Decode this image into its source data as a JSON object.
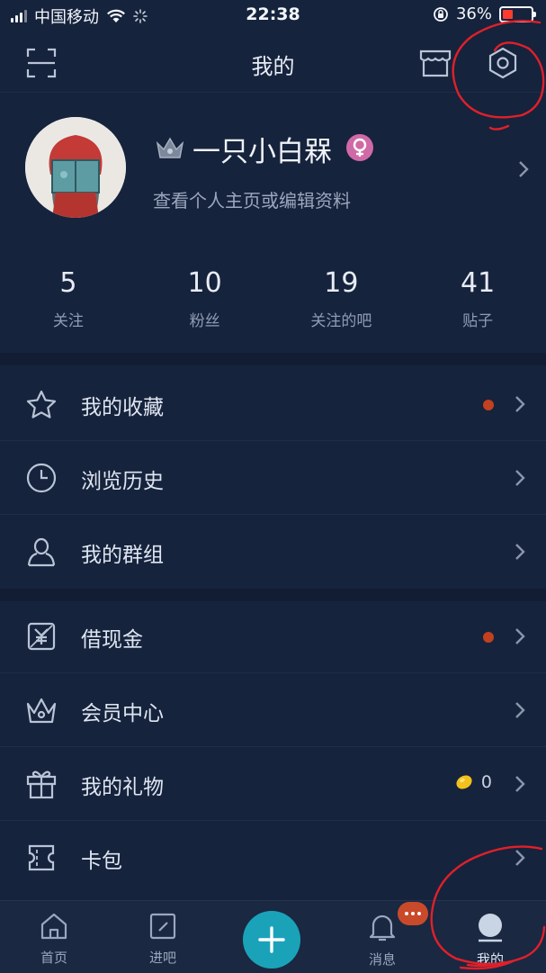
{
  "status_bar": {
    "carrier": "中国移动",
    "time": "22:38",
    "battery": "36%"
  },
  "nav": {
    "title": "我的",
    "icons": [
      "scan-icon",
      "store-icon",
      "settings-icon"
    ]
  },
  "profile": {
    "username": "一只小白槑",
    "subtitle": "查看个人主页或编辑资料",
    "gender": "female"
  },
  "stats": [
    {
      "value": "5",
      "label": "关注"
    },
    {
      "value": "10",
      "label": "粉丝"
    },
    {
      "value": "19",
      "label": "关注的吧"
    },
    {
      "value": "41",
      "label": "贴子"
    }
  ],
  "menu": {
    "favorites": "我的收藏",
    "history": "浏览历史",
    "groups": "我的群组",
    "borrow_cash": "借现金",
    "vip_center": "会员中心",
    "gifts": "我的礼物",
    "gift_count": "0",
    "card_pack": "卡包"
  },
  "tabs": {
    "home": "首页",
    "enter_bar": "进吧",
    "messages": "消息",
    "mine": "我的"
  },
  "colors": {
    "background": "#16233c",
    "accent": "#1aa3b8",
    "badge": "#c94a2a",
    "annotation": "#e0202a"
  }
}
